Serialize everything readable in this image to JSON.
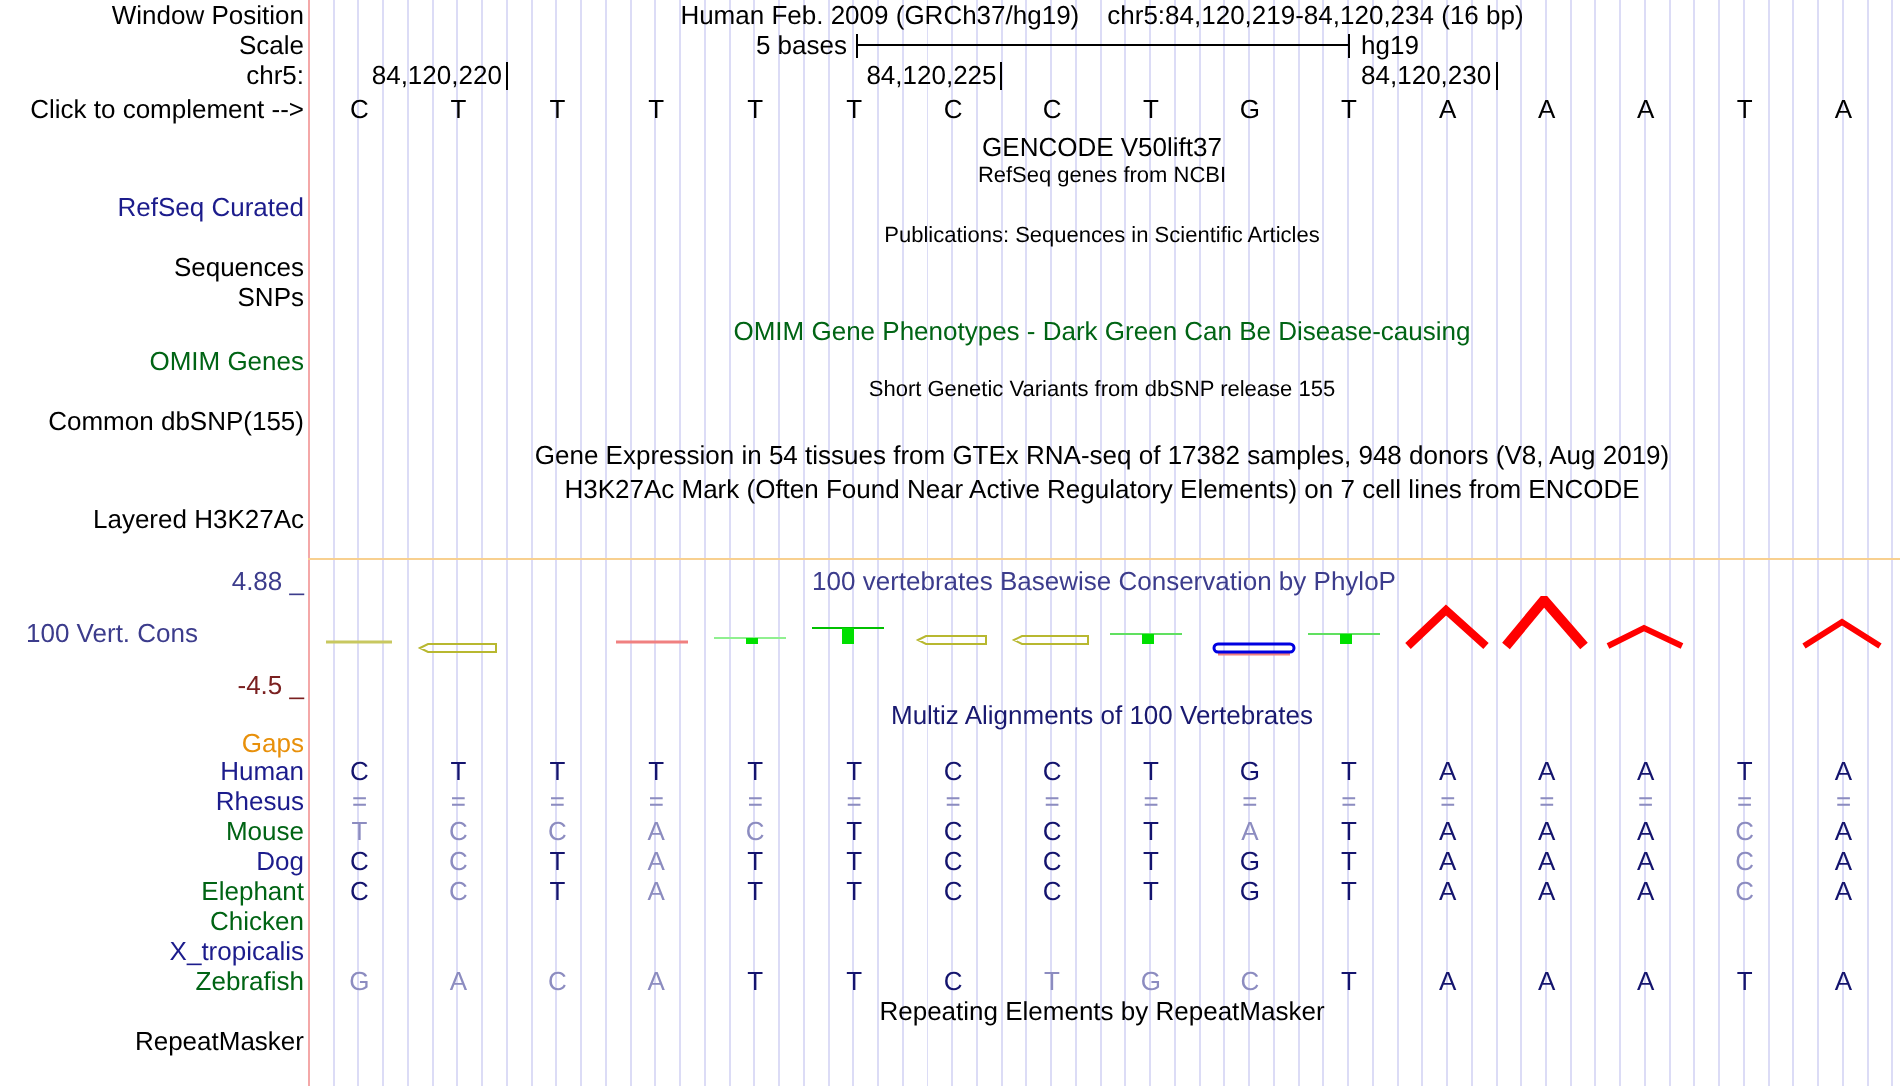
{
  "header": {
    "position_label": "Window Position",
    "position_assembly": "Human Feb. 2009 (GRCh37/hg19)",
    "position_range": "chr5:84,120,219-84,120,234 (16 bp)",
    "scale_label": "Scale",
    "scale_text": "5 bases",
    "assembly": "hg19",
    "ruler_label": "chr5:",
    "ruler_ticks": [
      "84,120,220",
      "84,120,225",
      "84,120,230"
    ],
    "complement_label": "Click to complement -->",
    "bases": [
      "C",
      "T",
      "T",
      "T",
      "T",
      "T",
      "C",
      "C",
      "T",
      "G",
      "T",
      "A",
      "A",
      "A",
      "T",
      "A"
    ]
  },
  "tracks": [
    {
      "kind": "title",
      "text": "GENCODE V50lift37",
      "color": "#000000"
    },
    {
      "kind": "subtitle",
      "text": "RefSeq genes from NCBI",
      "color": "#000000"
    },
    {
      "kind": "label",
      "text": "RefSeq Curated",
      "color": "#1c1c8c"
    },
    {
      "kind": "subtitle",
      "text": "Publications: Sequences in Scientific Articles",
      "color": "#000000"
    },
    {
      "kind": "label",
      "text": "Sequences",
      "color": "#000000"
    },
    {
      "kind": "label",
      "text": "SNPs",
      "color": "#000000"
    },
    {
      "kind": "title",
      "text": "OMIM Gene Phenotypes - Dark Green Can Be Disease-causing",
      "color": "#006414"
    },
    {
      "kind": "label",
      "text": "OMIM Genes",
      "color": "#006414"
    },
    {
      "kind": "subtitle",
      "text": "Short Genetic Variants from dbSNP release 155",
      "color": "#000000"
    },
    {
      "kind": "label",
      "text": "Common dbSNP(155)",
      "color": "#000000"
    },
    {
      "kind": "title",
      "text": "Gene Expression in 54 tissues from GTEx RNA-seq of 17382 samples, 948 donors (V8, Aug 2019)",
      "color": "#000000"
    },
    {
      "kind": "title",
      "text": "H3K27Ac Mark (Often Found Near Active Regulatory Elements) on 7 cell lines from ENCODE",
      "color": "#000000"
    },
    {
      "kind": "label",
      "text": "Layered H3K27Ac",
      "color": "#000000"
    }
  ],
  "conservation": {
    "title": "100 vertebrates Basewise Conservation by PhyloP",
    "label": "100 Vert. Cons",
    "max": "4.88 _",
    "min": "-4.5 _"
  },
  "alignment": {
    "title": "Multiz Alignments of 100 Vertebrates",
    "gaps_label": "Gaps",
    "species": [
      {
        "name": "Human",
        "color": "#1c1c8c",
        "bases": [
          {
            "b": "C",
            "dim": false
          },
          {
            "b": "T",
            "dim": false
          },
          {
            "b": "T",
            "dim": false
          },
          {
            "b": "T",
            "dim": false
          },
          {
            "b": "T",
            "dim": false
          },
          {
            "b": "T",
            "dim": false
          },
          {
            "b": "C",
            "dim": false
          },
          {
            "b": "C",
            "dim": false
          },
          {
            "b": "T",
            "dim": false
          },
          {
            "b": "G",
            "dim": false
          },
          {
            "b": "T",
            "dim": false
          },
          {
            "b": "A",
            "dim": false
          },
          {
            "b": "A",
            "dim": false
          },
          {
            "b": "A",
            "dim": false
          },
          {
            "b": "T",
            "dim": false
          },
          {
            "b": "A",
            "dim": false
          }
        ]
      },
      {
        "name": "Rhesus",
        "color": "#1c1c8c",
        "bases": [
          {
            "b": "=",
            "dim": true
          },
          {
            "b": "=",
            "dim": true
          },
          {
            "b": "=",
            "dim": true
          },
          {
            "b": "=",
            "dim": true
          },
          {
            "b": "=",
            "dim": true
          },
          {
            "b": "=",
            "dim": true
          },
          {
            "b": "=",
            "dim": true
          },
          {
            "b": "=",
            "dim": true
          },
          {
            "b": "=",
            "dim": true
          },
          {
            "b": "=",
            "dim": true
          },
          {
            "b": "=",
            "dim": true
          },
          {
            "b": "=",
            "dim": true
          },
          {
            "b": "=",
            "dim": true
          },
          {
            "b": "=",
            "dim": true
          },
          {
            "b": "=",
            "dim": true
          },
          {
            "b": "=",
            "dim": true
          }
        ]
      },
      {
        "name": "Mouse",
        "color": "#006414",
        "bases": [
          {
            "b": "T",
            "dim": true
          },
          {
            "b": "C",
            "dim": true
          },
          {
            "b": "C",
            "dim": true
          },
          {
            "b": "A",
            "dim": true
          },
          {
            "b": "C",
            "dim": true
          },
          {
            "b": "T",
            "dim": false
          },
          {
            "b": "C",
            "dim": false
          },
          {
            "b": "C",
            "dim": false
          },
          {
            "b": "T",
            "dim": false
          },
          {
            "b": "A",
            "dim": true
          },
          {
            "b": "T",
            "dim": false
          },
          {
            "b": "A",
            "dim": false
          },
          {
            "b": "A",
            "dim": false
          },
          {
            "b": "A",
            "dim": false
          },
          {
            "b": "C",
            "dim": true
          },
          {
            "b": "A",
            "dim": false
          }
        ]
      },
      {
        "name": "Dog",
        "color": "#1c1c8c",
        "bases": [
          {
            "b": "C",
            "dim": false
          },
          {
            "b": "C",
            "dim": true
          },
          {
            "b": "T",
            "dim": false
          },
          {
            "b": "A",
            "dim": true
          },
          {
            "b": "T",
            "dim": false
          },
          {
            "b": "T",
            "dim": false
          },
          {
            "b": "C",
            "dim": false
          },
          {
            "b": "C",
            "dim": false
          },
          {
            "b": "T",
            "dim": false
          },
          {
            "b": "G",
            "dim": false
          },
          {
            "b": "T",
            "dim": false
          },
          {
            "b": "A",
            "dim": false
          },
          {
            "b": "A",
            "dim": false
          },
          {
            "b": "A",
            "dim": false
          },
          {
            "b": "C",
            "dim": true
          },
          {
            "b": "A",
            "dim": false
          }
        ]
      },
      {
        "name": "Elephant",
        "color": "#006414",
        "bases": [
          {
            "b": "C",
            "dim": false
          },
          {
            "b": "C",
            "dim": true
          },
          {
            "b": "T",
            "dim": false
          },
          {
            "b": "A",
            "dim": true
          },
          {
            "b": "T",
            "dim": false
          },
          {
            "b": "T",
            "dim": false
          },
          {
            "b": "C",
            "dim": false
          },
          {
            "b": "C",
            "dim": false
          },
          {
            "b": "T",
            "dim": false
          },
          {
            "b": "G",
            "dim": false
          },
          {
            "b": "T",
            "dim": false
          },
          {
            "b": "A",
            "dim": false
          },
          {
            "b": "A",
            "dim": false
          },
          {
            "b": "A",
            "dim": false
          },
          {
            "b": "C",
            "dim": true
          },
          {
            "b": "A",
            "dim": false
          }
        ]
      },
      {
        "name": "Chicken",
        "color": "#006414"
      },
      {
        "name": "X_tropicalis",
        "color": "#1c1c8c"
      },
      {
        "name": "Zebrafish",
        "color": "#006414",
        "bases": [
          {
            "b": "G",
            "dim": true
          },
          {
            "b": "A",
            "dim": true
          },
          {
            "b": "C",
            "dim": true
          },
          {
            "b": "A",
            "dim": true
          },
          {
            "b": "T",
            "dim": false
          },
          {
            "b": "T",
            "dim": false
          },
          {
            "b": "C",
            "dim": false
          },
          {
            "b": "T",
            "dim": true
          },
          {
            "b": "G",
            "dim": true
          },
          {
            "b": "C",
            "dim": true
          },
          {
            "b": "T",
            "dim": false
          },
          {
            "b": "A",
            "dim": false
          },
          {
            "b": "A",
            "dim": false
          },
          {
            "b": "A",
            "dim": false
          },
          {
            "b": "T",
            "dim": false
          },
          {
            "b": "A",
            "dim": false
          }
        ]
      }
    ]
  },
  "repeats": {
    "title": "Repeating Elements by RepeatMasker",
    "label": "RepeatMasker"
  }
}
